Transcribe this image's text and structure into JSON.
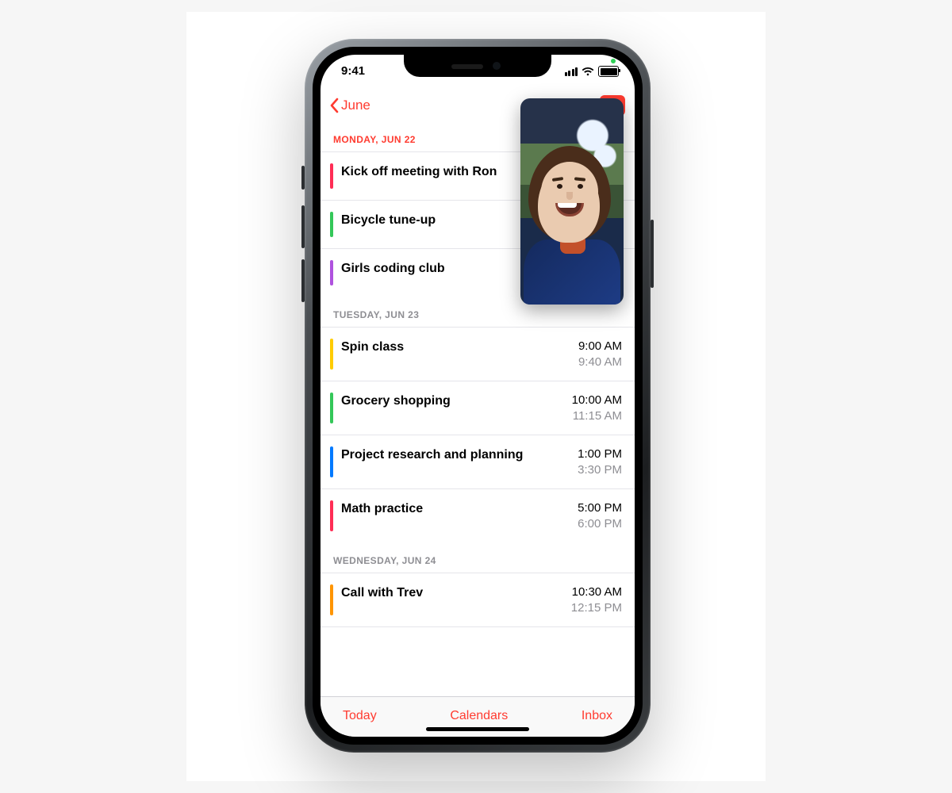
{
  "status": {
    "time": "9:41"
  },
  "nav": {
    "back_label": "June",
    "view_mode": "list"
  },
  "colors": {
    "accent": "#ff3b30",
    "pink": "#ff2d55",
    "green": "#34c759",
    "purple": "#af52de",
    "yellow": "#ffcc00",
    "blue": "#007aff",
    "orange": "#ff9500"
  },
  "sections": [
    {
      "header": "MONDAY, JUN 22",
      "style": "primary",
      "events": [
        {
          "title": "Kick off meeting with Ron",
          "color": "pink",
          "start": "",
          "end": ""
        },
        {
          "title": "Bicycle tune-up",
          "color": "green",
          "start": "",
          "end": ""
        },
        {
          "title": "Girls coding club",
          "color": "purple",
          "start": "",
          "end": ""
        }
      ]
    },
    {
      "header": "TUESDAY, JUN 23",
      "style": "muted",
      "events": [
        {
          "title": "Spin class",
          "color": "yellow",
          "start": "9:00 AM",
          "end": "9:40 AM"
        },
        {
          "title": "Grocery shopping",
          "color": "green",
          "start": "10:00 AM",
          "end": "11:15 AM"
        },
        {
          "title": "Project research and planning",
          "color": "blue",
          "start": "1:00 PM",
          "end": "3:30 PM"
        },
        {
          "title": "Math practice",
          "color": "pink",
          "start": "5:00 PM",
          "end": "6:00 PM"
        }
      ]
    },
    {
      "header": "WEDNESDAY, JUN 24",
      "style": "muted",
      "events": [
        {
          "title": "Call with Trev",
          "color": "orange",
          "start": "10:30 AM",
          "end": "12:15 PM"
        }
      ]
    }
  ],
  "toolbar": {
    "today": "Today",
    "calendars": "Calendars",
    "inbox": "Inbox"
  },
  "pip": {
    "description": "facetime-pip-person"
  }
}
